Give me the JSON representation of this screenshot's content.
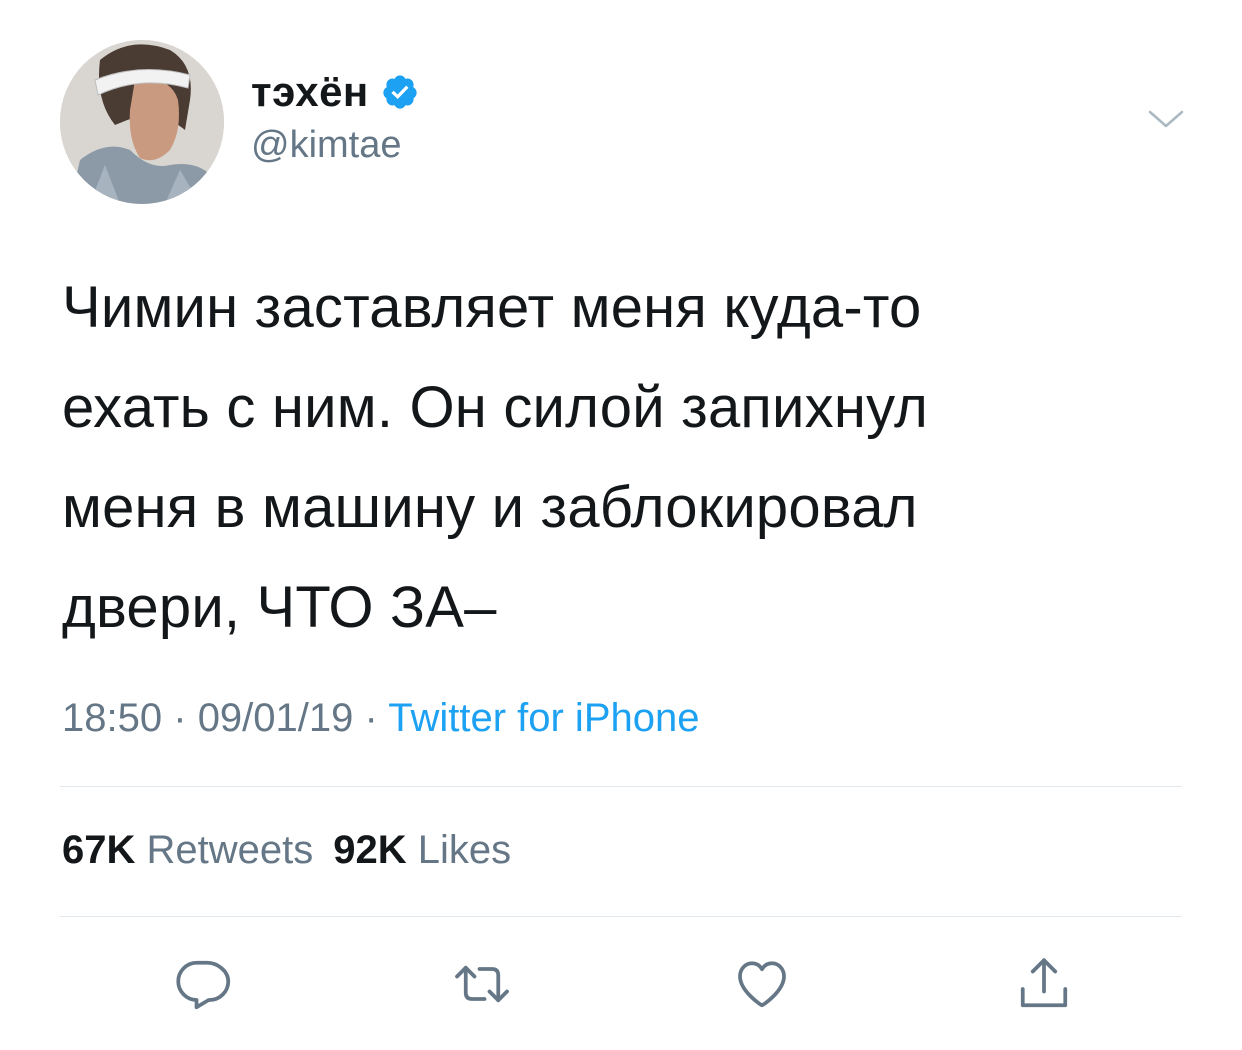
{
  "tweet": {
    "display_name": "тэхён",
    "handle": "@kimtae",
    "verified": true,
    "text_lines": [
      "Чимин заставляет меня куда-то",
      "ехать с ним. Он силой запихнул",
      "меня в машину и заблокировал",
      "двери, ЧТО ЗА–"
    ],
    "time": "18:50",
    "date": "09/01/19",
    "separator": "·",
    "source": "Twitter for iPhone"
  },
  "stats": {
    "retweets_count": "67K",
    "retweets_label": "Retweets",
    "likes_count": "92K",
    "likes_label": "Likes"
  },
  "actions": {
    "reply_icon": "reply-icon",
    "retweet_icon": "retweet-icon",
    "like_icon": "heart-icon",
    "share_icon": "share-icon"
  },
  "colors": {
    "text": "#14171a",
    "secondary": "#657786",
    "accent": "#1da1f2",
    "divider": "#e1e8ed"
  }
}
